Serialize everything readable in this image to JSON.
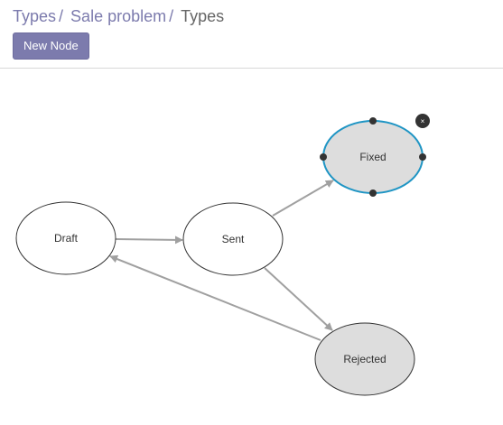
{
  "breadcrumb": {
    "items": [
      "Types",
      "Sale problem"
    ],
    "separator": "/",
    "current": "Types"
  },
  "toolbar": {
    "new_node_label": "New Node"
  },
  "diagram": {
    "nodes": [
      {
        "id": "draft",
        "label": "Draft",
        "selected": false,
        "fill": "#ffffff"
      },
      {
        "id": "sent",
        "label": "Sent",
        "selected": false,
        "fill": "#ffffff"
      },
      {
        "id": "fixed",
        "label": "Fixed",
        "selected": true,
        "fill": "#dddddd"
      },
      {
        "id": "rejected",
        "label": "Rejected",
        "selected": false,
        "fill": "#dddddd"
      }
    ],
    "edges": [
      {
        "from": "draft",
        "to": "sent"
      },
      {
        "from": "sent",
        "to": "fixed"
      },
      {
        "from": "sent",
        "to": "rejected"
      },
      {
        "from": "rejected",
        "to": "draft"
      }
    ],
    "close_label": "×",
    "colors": {
      "selection_stroke": "#1f95c4",
      "edge": "#a0a0a0",
      "node_stroke": "#333333",
      "handle": "#333333"
    }
  }
}
